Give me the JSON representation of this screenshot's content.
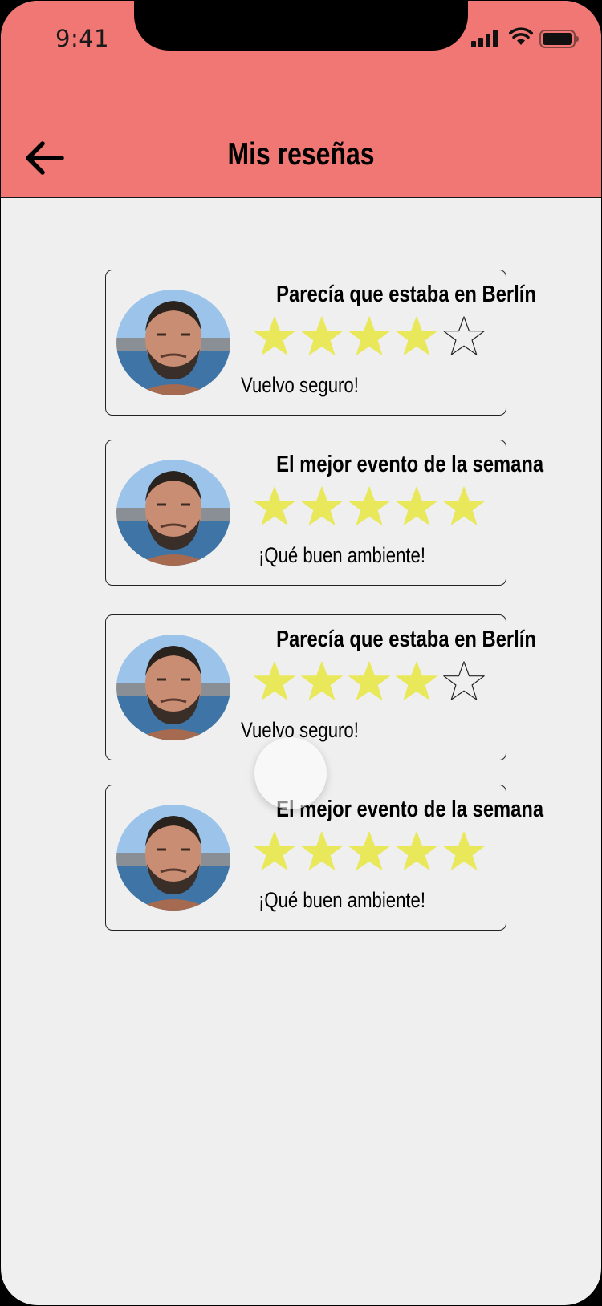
{
  "status_bar": {
    "time": "9:41"
  },
  "header": {
    "title": "Mis reseñas"
  },
  "colors": {
    "header_bg": "#f07773",
    "star_filled": "#e8e85a",
    "background": "#efefef"
  },
  "reviews": [
    {
      "title": "Parecía que estaba en Berlín",
      "rating": 4,
      "max_rating": 5,
      "text": "Vuelvo seguro!"
    },
    {
      "title": "El mejor evento de la semana",
      "rating": 5,
      "max_rating": 5,
      "text": "¡Qué buen ambiente!"
    },
    {
      "title": "Parecía que estaba en Berlín",
      "rating": 4,
      "max_rating": 5,
      "text": "Vuelvo seguro!"
    },
    {
      "title": "El mejor evento de la semana",
      "rating": 5,
      "max_rating": 5,
      "text": "¡Qué buen ambiente!"
    }
  ],
  "icons": {
    "back": "arrow-left-icon",
    "signal": "cellular-signal-icon",
    "wifi": "wifi-icon",
    "battery": "battery-icon",
    "star": "star-icon"
  }
}
